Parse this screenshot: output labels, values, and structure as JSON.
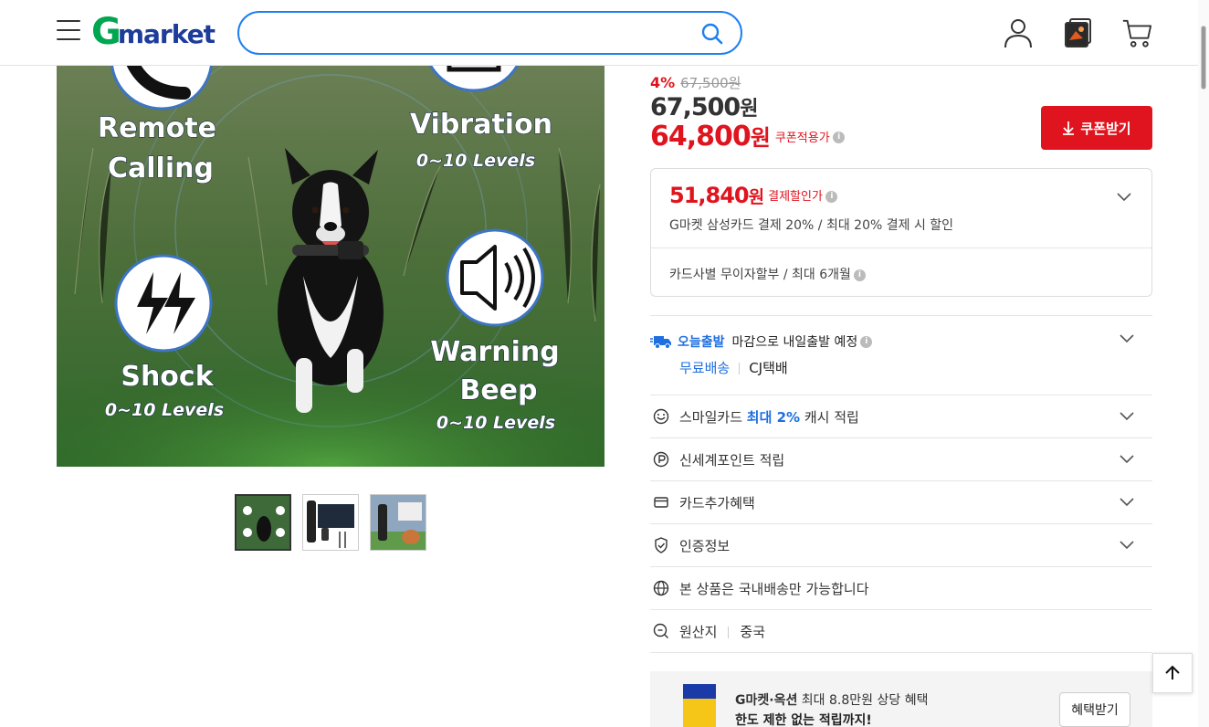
{
  "header": {
    "logo_g": "G",
    "logo_rest": "market",
    "search_value": "",
    "search_placeholder": ""
  },
  "gallery": {
    "features": [
      {
        "label_line1": "Remote",
        "label_line2": "Calling",
        "sub": ""
      },
      {
        "label_line1": "Vibration",
        "label_line2": "",
        "sub": "0~10  Levels"
      },
      {
        "label_line1": "Shock",
        "label_line2": "",
        "sub": "0~10  Levels"
      },
      {
        "label_line1": "Warning",
        "label_line2": "Beep",
        "sub": "0~10  Levels"
      }
    ],
    "thumbnail_count": 3
  },
  "price": {
    "discount_pct": "4%",
    "original_price": "67,500원",
    "sale_price_num": "67,500",
    "won": "원",
    "coupon_price_num": "64,800",
    "coupon_price_label": "쿠폰적용가",
    "coupon_button": "쿠폰받기"
  },
  "card_discount": {
    "price_num": "51,840",
    "won": "원",
    "label": "결제할인가",
    "desc": "G마켓 삼성카드 결제 20% / 최대 20% 결제 시 할인",
    "installment": "카드사별 무이자할부 / 최대 6개월"
  },
  "shipping": {
    "today_label": "오늘출발",
    "schedule": "마감으로 내일출발 예정",
    "free": "무료배송",
    "carrier": "CJ택배"
  },
  "rows": {
    "smilecard_pre": "스마일카드 ",
    "smilecard_highlight": "최대 2%",
    "smilecard_post": " 캐시 적립",
    "shinsegae": "신세계포인트 적립",
    "card_benefit": "카드추가혜택",
    "certification": "인증정보",
    "domestic": "본 상품은 국내배송만 가능합니다",
    "origin_label": "원산지",
    "origin_value": "중국"
  },
  "banner": {
    "title_bold": "G마켓·옥션",
    "title_rest": " 최대 8.8만원 상당 혜택",
    "subtitle": "한도 제한 없는 적립까지!",
    "button": "혜택받기"
  },
  "colors": {
    "brand_green": "#00a650",
    "brand_blue": "#1d3c9b",
    "accent_red": "#e0141e",
    "link_blue": "#1f6fe0"
  }
}
